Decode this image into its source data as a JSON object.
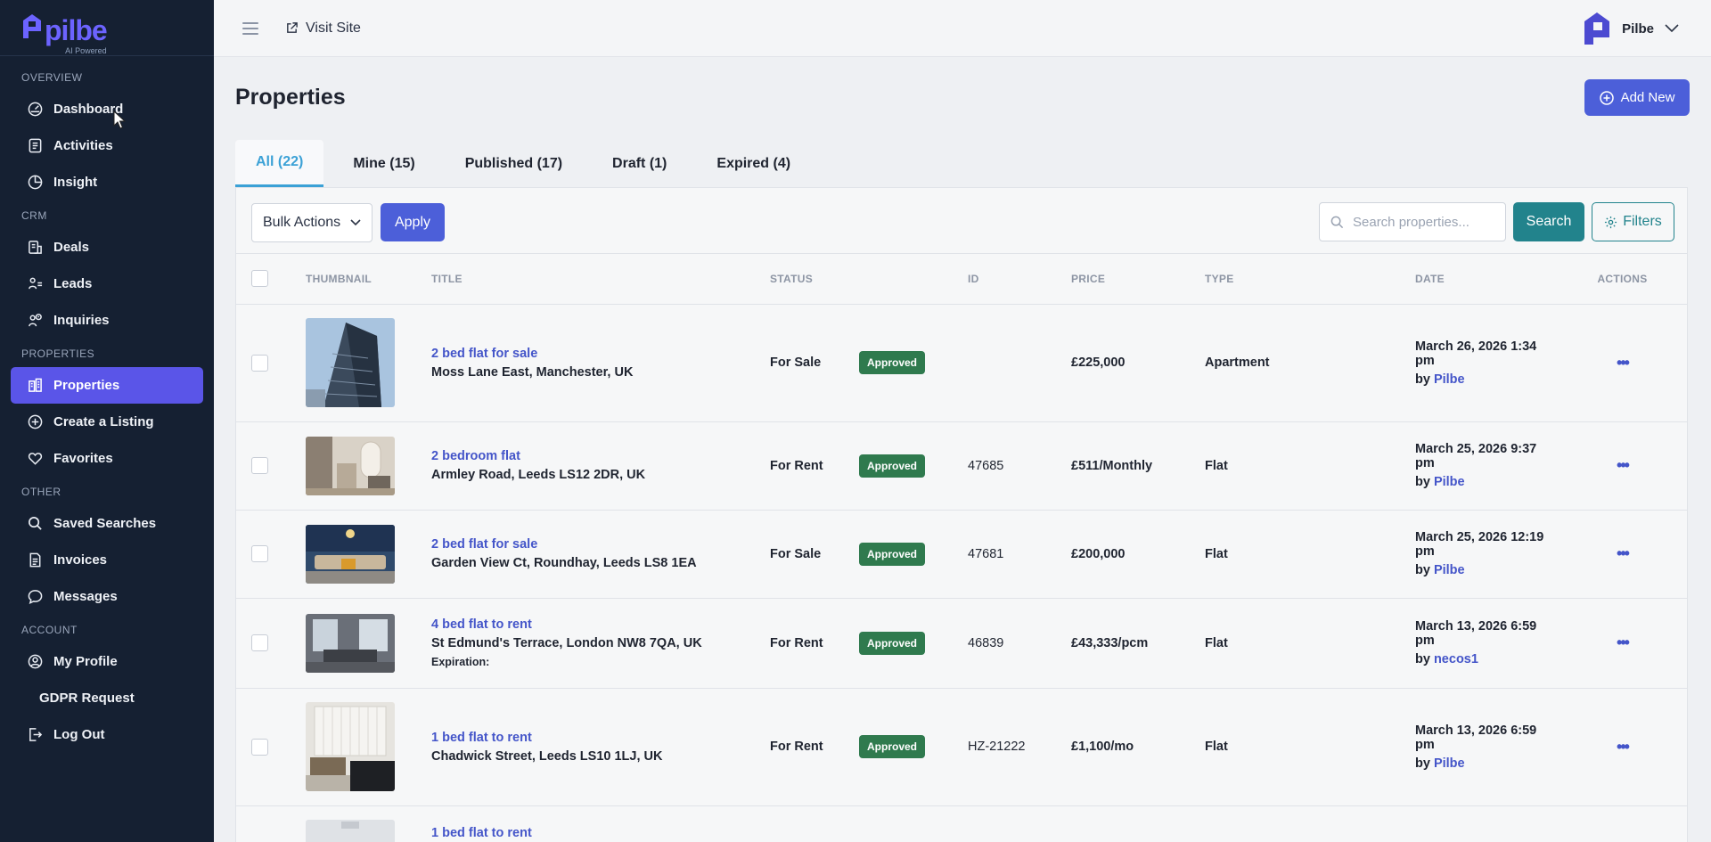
{
  "brand": {
    "name": "pilbe",
    "tagline": "AI Powered",
    "color": "#6c63ff"
  },
  "sidebar": {
    "sections": [
      {
        "label": "OVERVIEW",
        "items": [
          {
            "label": "Dashboard",
            "icon": "dashboard-icon"
          },
          {
            "label": "Activities",
            "icon": "activities-icon"
          },
          {
            "label": "Insight",
            "icon": "insight-icon"
          }
        ]
      },
      {
        "label": "CRM",
        "items": [
          {
            "label": "Deals",
            "icon": "deals-icon"
          },
          {
            "label": "Leads",
            "icon": "leads-icon"
          },
          {
            "label": "Inquiries",
            "icon": "inquiries-icon"
          }
        ]
      },
      {
        "label": "PROPERTIES",
        "items": [
          {
            "label": "Properties",
            "icon": "properties-icon",
            "active": true
          },
          {
            "label": "Create a Listing",
            "icon": "plus-circle-icon"
          },
          {
            "label": "Favorites",
            "icon": "heart-icon"
          }
        ]
      },
      {
        "label": "OTHER",
        "items": [
          {
            "label": "Saved Searches",
            "icon": "search-icon"
          },
          {
            "label": "Invoices",
            "icon": "invoice-icon"
          },
          {
            "label": "Messages",
            "icon": "message-icon"
          }
        ]
      },
      {
        "label": "ACCOUNT",
        "items": [
          {
            "label": "My Profile",
            "icon": "profile-icon"
          },
          {
            "label": "GDPR Request",
            "icon": ""
          },
          {
            "label": "Log Out",
            "icon": "logout-icon"
          }
        ]
      }
    ]
  },
  "topbar": {
    "visit_site": "Visit Site",
    "user_name": "Pilbe"
  },
  "page": {
    "title": "Properties",
    "add_new": "Add New"
  },
  "tabs": [
    {
      "label": "All (22)",
      "active": true
    },
    {
      "label": "Mine (15)"
    },
    {
      "label": "Published (17)"
    },
    {
      "label": "Draft (1)"
    },
    {
      "label": "Expired (4)"
    }
  ],
  "toolbar": {
    "bulk_actions": "Bulk Actions",
    "apply": "Apply",
    "search_placeholder": "Search properties...",
    "search": "Search",
    "filters": "Filters"
  },
  "table": {
    "columns": [
      "THUMBNAIL",
      "TITLE",
      "STATUS",
      "ID",
      "PRICE",
      "TYPE",
      "DATE",
      "ACTIONS"
    ],
    "rows": [
      {
        "title": "2 bed flat for sale",
        "address": "Moss Lane East, Manchester, UK",
        "expiration": "",
        "listing": "For Sale",
        "status": "Approved",
        "id": "",
        "price": "£225,000",
        "type": "Apartment",
        "date": "March 26, 2026 1:34 pm",
        "by_prefix": "by",
        "by": "Pilbe"
      },
      {
        "title": "2 bedroom flat",
        "address": "Armley Road, Leeds LS12 2DR, UK",
        "expiration": "",
        "listing": "For Rent",
        "status": "Approved",
        "id": "47685",
        "price": "£511/Monthly",
        "type": "Flat",
        "date": "March 25, 2026 9:37 pm",
        "by_prefix": "by",
        "by": "Pilbe"
      },
      {
        "title": "2 bed flat for sale",
        "address": "Garden View Ct, Roundhay, Leeds LS8 1EA",
        "expiration": "",
        "listing": "For Sale",
        "status": "Approved",
        "id": "47681",
        "price": "£200,000",
        "type": "Flat",
        "date": "March 25, 2026 12:19 pm",
        "by_prefix": "by",
        "by": "Pilbe"
      },
      {
        "title": "4 bed flat to rent",
        "address": "St Edmund's Terrace, London NW8 7QA, UK",
        "expiration": "Expiration:",
        "listing": "For Rent",
        "status": "Approved",
        "id": "46839",
        "price": "£43,333/pcm",
        "type": "Flat",
        "date": "March 13, 2026 6:59 pm",
        "by_prefix": "by",
        "by": "necos1"
      },
      {
        "title": "1 bed flat to rent",
        "address": "Chadwick Street, Leeds LS10 1LJ, UK",
        "expiration": "",
        "listing": "For Rent",
        "status": "Approved",
        "id": "HZ-21222",
        "price": "£1,100/mo",
        "type": "Flat",
        "date": "March 13, 2026 6:59 pm",
        "by_prefix": "by",
        "by": "Pilbe"
      },
      {
        "title": "1 bed flat to rent",
        "address": "",
        "expiration": "",
        "listing": "",
        "status": "",
        "id": "",
        "price": "",
        "type": "",
        "date": "",
        "by_prefix": "",
        "by": ""
      }
    ]
  },
  "colors": {
    "accent": "#4c5fd9",
    "teal": "#22838c",
    "sidebar": "#152032",
    "approved": "#2f7a4e",
    "tab_active": "#3ba1d6"
  }
}
